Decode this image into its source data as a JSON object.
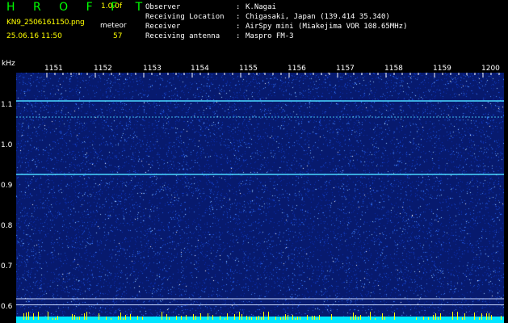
{
  "header": {
    "title": "H R O F F T",
    "version": "1.0.0f",
    "filename": "KN9_2506161150.png",
    "mode": "meteor",
    "datetime": "25.06.16 11:50",
    "count": "57"
  },
  "info": [
    {
      "label": "Observer",
      "value": "K.Nagai"
    },
    {
      "label": "Receiving Location",
      "value": "Chigasaki, Japan (139.414 35.340)"
    },
    {
      "label": "Receiver",
      "value": "AirSpy mini (Miakejima VOR 108.65MHz)"
    },
    {
      "label": "Receiving antenna",
      "value": "Maspro FM-3"
    }
  ],
  "axis": {
    "y_unit": "kHz",
    "y_ticks": [
      "1.1",
      "1.0",
      "0.9",
      "0.8",
      "0.7",
      "0.6"
    ],
    "x_ticks": [
      "1151",
      "1152",
      "1153",
      "1154",
      "1155",
      "1156",
      "1157",
      "1158",
      "1159",
      "1200"
    ]
  },
  "colors": {
    "title": "#00ff00",
    "version": "#ffff00",
    "header_text": "#ffffff",
    "background": "#000000",
    "spectrogram_base": "#071a6e",
    "carrier_line": "#4ad8ff",
    "bottom_band": "#00e5ff",
    "bottom_spikes": "#ffff00"
  },
  "signal_lines_khz": [
    1.11,
    1.07,
    0.928
  ],
  "reference_lines_khz": [
    0.62,
    0.605
  ]
}
